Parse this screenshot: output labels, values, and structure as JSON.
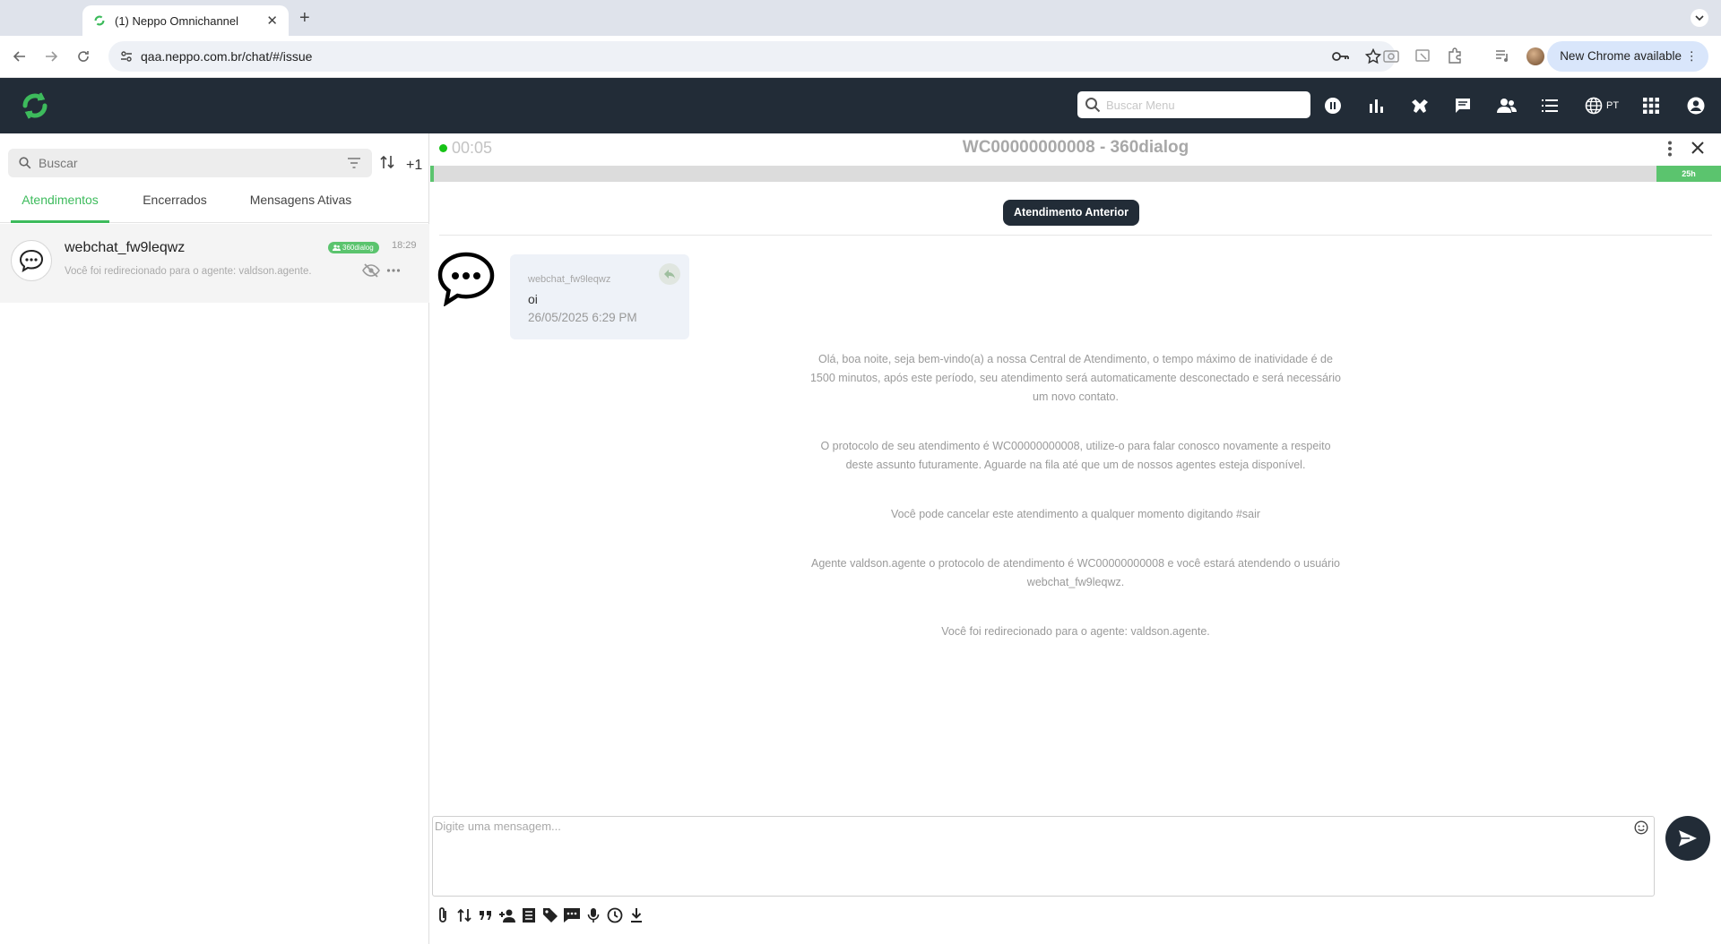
{
  "browser": {
    "tab_title": "(1) Neppo Omnichannel",
    "url": "qaa.neppo.com.br/chat/#/issue",
    "new_chrome": "New Chrome available"
  },
  "header": {
    "search_placeholder": "Buscar Menu",
    "language": "PT"
  },
  "sidebar": {
    "search_placeholder": "Buscar",
    "plus_label": "+1",
    "tabs": [
      {
        "label": "Atendimentos"
      },
      {
        "label": "Encerrados"
      },
      {
        "label": "Mensagens Ativas"
      }
    ],
    "conversation": {
      "name": "webchat_fw9leqwz",
      "badge": "360dialog",
      "time": "18:29",
      "preview": "Você foi redirecionado para o agente: valdson.agente."
    }
  },
  "chat": {
    "timer": "00:05",
    "title": "WC00000000008 - 360dialog",
    "progress_label": "25h",
    "previous_button": "Atendimento Anterior",
    "message": {
      "sender": "webchat_fw9leqwz",
      "text": "oi",
      "date": "26/05/2025 6:29 PM"
    },
    "system_messages": [
      "Olá, boa noite, seja bem-vindo(a) a nossa Central de Atendimento, o tempo máximo de inatividade é de 1500 minutos, após este período, seu atendimento será automaticamente desconectado e será necessário um novo contato.",
      "O protocolo de seu atendimento é WC00000000008, utilize-o para falar conosco novamente a respeito deste assunto futuramente. Aguarde na fila até que um de nossos agentes esteja disponível.",
      "Você pode cancelar este atendimento a qualquer momento digitando #sair",
      "Agente valdson.agente o protocolo de atendimento é WC00000000008 e você estará atendendo o usuário webchat_fw9leqwz.",
      "Você foi redirecionado para o agente: valdson.agente."
    ],
    "composer_placeholder": "Digite uma mensagem..."
  },
  "colors": {
    "header_bg": "#222c37",
    "accent_green": "#3dbb5c",
    "online": "#16c316"
  }
}
